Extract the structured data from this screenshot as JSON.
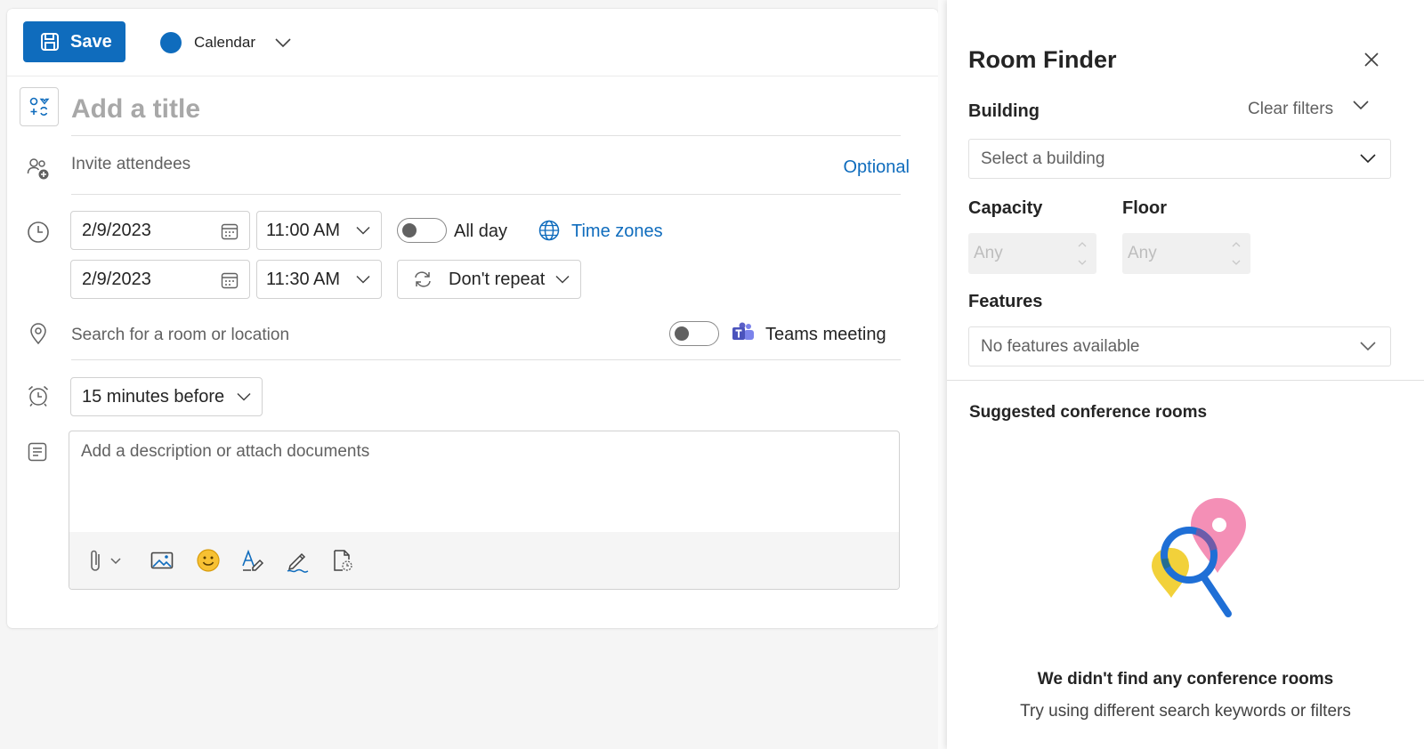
{
  "editor": {
    "save_label": "Save",
    "calendar_label": "Calendar",
    "calendar_color": "#0f6cbd",
    "title_placeholder": "Add a title",
    "invite_placeholder": "Invite attendees",
    "optional_label": "Optional",
    "start_date": "2/9/2023",
    "start_time": "11:00 AM",
    "end_date": "2/9/2023",
    "end_time": "11:30 AM",
    "all_day_label": "All day",
    "time_zones_label": "Time zones",
    "repeat_label": "Don't repeat",
    "location_placeholder": "Search for a room or location",
    "teams_label": "Teams meeting",
    "reminder_label": "15 minutes before",
    "description_placeholder": "Add a description or attach documents",
    "icons": [
      "save-icon",
      "title-emoji-icon",
      "people-add-icon",
      "clock-icon",
      "calendar-icon",
      "globe-icon",
      "repeat-icon",
      "location-icon",
      "teams-icon",
      "alarm-icon",
      "notes-icon",
      "paperclip-icon",
      "image-icon",
      "emoji-icon",
      "format-icon",
      "signature-icon",
      "loop-icon"
    ]
  },
  "room_finder": {
    "title": "Room Finder",
    "building_label": "Building",
    "clear_filters_label": "Clear filters",
    "building_placeholder": "Select a building",
    "capacity_label": "Capacity",
    "floor_label": "Floor",
    "capacity_value": "Any",
    "floor_value": "Any",
    "features_label": "Features",
    "features_placeholder": "No features available",
    "suggested_label": "Suggested conference rooms",
    "empty_title": "We didn't find any conference rooms",
    "empty_subtitle": "Try using different search keywords or filters"
  },
  "colors": {
    "accent": "#0f6cbd",
    "teams": "#5b5fc7",
    "illustration_blue": "#1f6fd6",
    "illustration_pink": "#f48fb6",
    "illustration_yellow": "#f2d13a"
  }
}
